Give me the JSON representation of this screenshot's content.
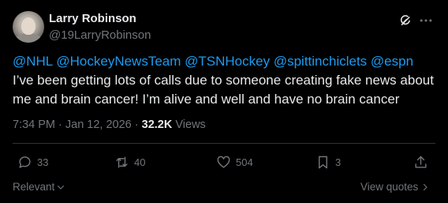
{
  "author": {
    "name": "Larry Robinson",
    "handle": "@19LarryRobinson"
  },
  "post": {
    "mentions": [
      "@NHL",
      "@HockeyNewsTeam",
      "@TSNHockey",
      "@spittinchiclets",
      "@espn"
    ],
    "text": "I’ve been getting lots of calls due to someone creating fake news about me and brain cancer! I’m alive and well and have no brain cancer",
    "time": "7:34 PM",
    "date": "Jan 12, 2026",
    "views_count": "32.2K",
    "views_label": "Views"
  },
  "actions": {
    "replies": "33",
    "reposts": "40",
    "likes": "504",
    "bookmarks": "3"
  },
  "footer": {
    "sort_label": "Relevant",
    "view_quotes_label": "View quotes"
  },
  "colors": {
    "background": "#000000",
    "text": "#e7e9ea",
    "muted": "#71767b",
    "link": "#1d9bf0"
  },
  "icons": {
    "top_right": [
      "grok-icon",
      "more-icon"
    ],
    "actions": [
      "reply-icon",
      "repost-icon",
      "like-icon",
      "bookmark-icon",
      "share-icon"
    ]
  }
}
